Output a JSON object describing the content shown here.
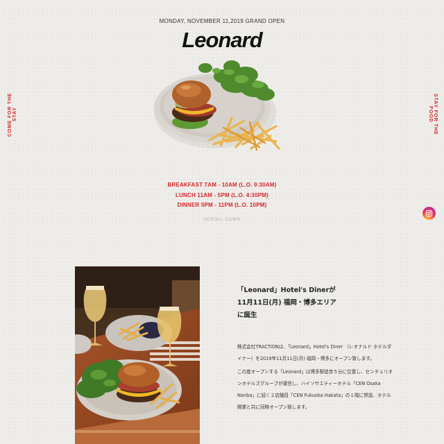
{
  "header": {
    "grand_open": "MONDAY, NOVEMBER 11,2019 GRAND OPEN",
    "logo_text": "Leonard"
  },
  "side": {
    "left_text": "COME FOR THE STAY",
    "right_text": "STAY FOR THE FOOD"
  },
  "hours": [
    "BREAKFAST 7AM - 10AM (L.O. 9:30AM)",
    "LUNCH 11AM - 5PM (L.O. 4:30PM)",
    "DINNER 5PM - 11PM (L.O. 10PM)"
  ],
  "scroll_label": "SCROLL DOWN",
  "social": {
    "icon": "instagram-icon"
  },
  "intro": {
    "headline_lines": [
      "「Leonard」Hotel's Dinerが",
      "11月11日(月) 福岡・博多エリア",
      "に誕生"
    ],
    "paragraph1": "株式会社TRACTIONは、「Leonard」Hotel's Diner （レオナルド ホテルダイナー）を2019年11月11日(月) 福岡・博多にオープン致します。",
    "paragraph2": "この度オープンする「Leonard」は博多駅徒歩５分に位置し、センチュリオンホテルズグループが運営し、ハイソサエティーホテル「CEN Osaka Nanba」に続く２店舗目「CEN Fukuoka Hakata」の１階に併設、ホテル開業と共に同時オープン致します。"
  },
  "colors": {
    "accent_red": "#d4262b",
    "background": "#efede9",
    "text": "#222222"
  }
}
